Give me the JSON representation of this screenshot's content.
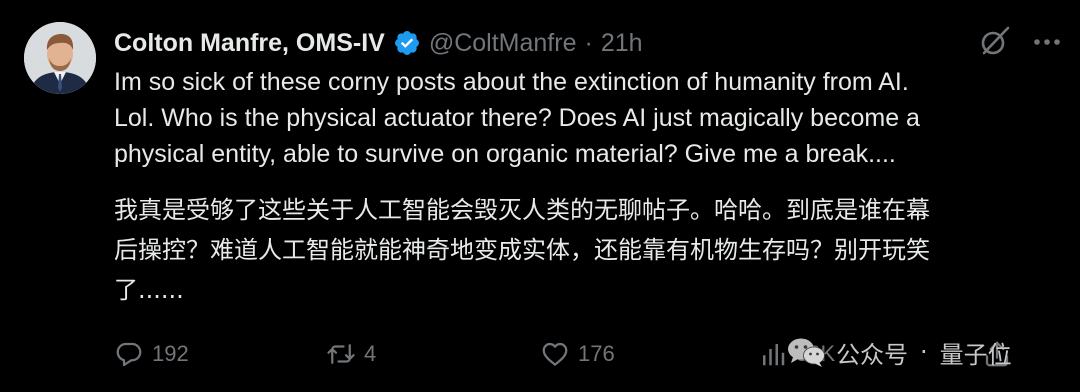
{
  "tweet": {
    "author": {
      "display_name": "Colton Manfre, OMS-IV",
      "handle": "@ColtManfre",
      "separator": "·",
      "time": "21h",
      "verified": true,
      "avatar_icon": "avatar-photo"
    },
    "text_en_lines": [
      "Im so sick of these corny posts about the extinction of humanity from AI.",
      "Lol. Who is the physical actuator there? Does AI just magically become a",
      "physical entity, able to survive on organic material? Give me a break...."
    ],
    "text_zh_lines": [
      "我真是受够了这些关于人工智能会毁灭人类的无聊帖子。哈哈。到底是谁在幕",
      "后操控？难道人工智能就能神奇地变成实体，还能靠有机物生存吗？别开玩笑",
      "了......"
    ],
    "actions": {
      "reply_count": "192",
      "retweet_count": "4",
      "like_count": "176",
      "views_count": "83K"
    },
    "top_icons": [
      "grok-icon",
      "more-icon"
    ]
  },
  "watermark": {
    "label": "公众号",
    "separator": "·",
    "name": "量子位"
  },
  "colors": {
    "background": "#000000",
    "text_primary": "#e7e9ea",
    "text_secondary": "#71767b",
    "verified_blue": "#1d9bf0"
  }
}
